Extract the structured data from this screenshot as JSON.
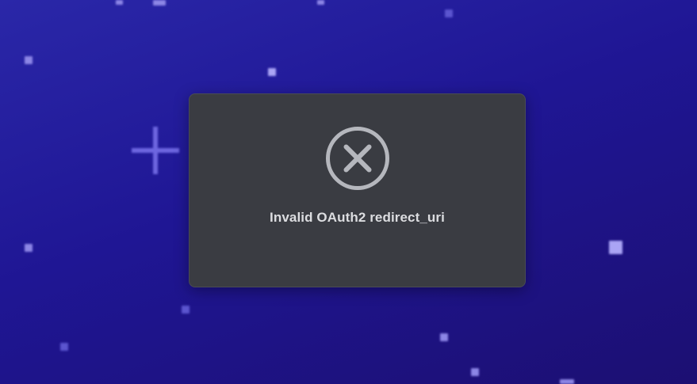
{
  "background": {
    "gradient_colors": [
      "#2a27a8",
      "#1f1694",
      "#1c0f72"
    ],
    "decor_icon": "sparkle-icon"
  },
  "dialog": {
    "icon": "error-circle-x-icon",
    "icon_color": "#b5b7bd",
    "background_color": "#3a3c42",
    "message": "Invalid OAuth2 redirect_uri"
  }
}
